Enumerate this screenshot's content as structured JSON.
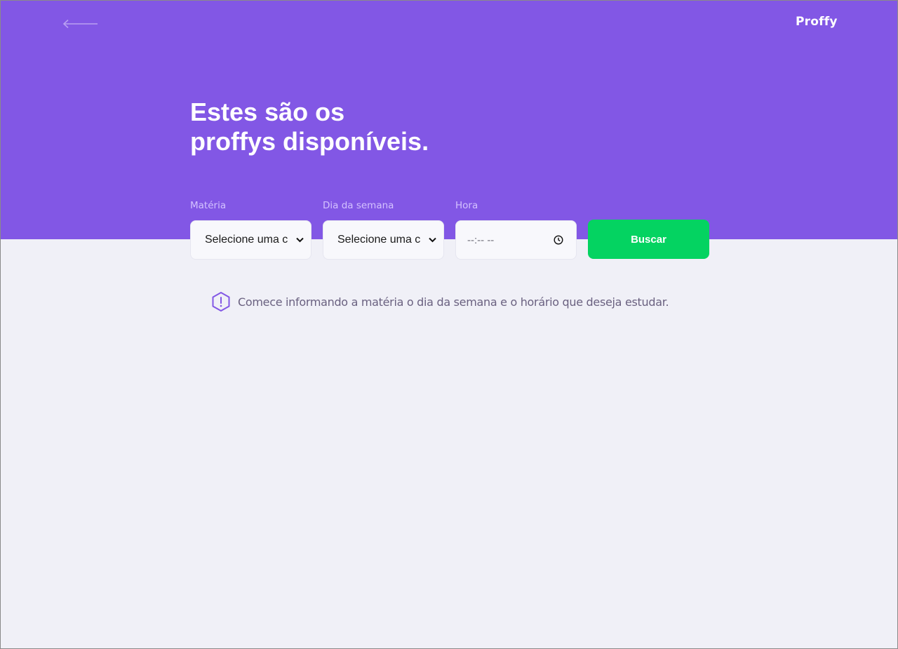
{
  "header": {
    "logo": "Proffy",
    "title_line1": "Estes são os",
    "title_line2": "proffys disponíveis."
  },
  "filters": {
    "subject": {
      "label": "Matéria",
      "value": "Selecione uma c"
    },
    "weekday": {
      "label": "Dia da semana",
      "value": "Selecione uma c"
    },
    "time": {
      "label": "Hora",
      "value": "--:-- --"
    },
    "submit_label": "Buscar"
  },
  "hint": {
    "text": "Comece informando a matéria o dia da semana e o horário que deseja estudar."
  },
  "colors": {
    "primary": "#8257E5",
    "background": "#F0F0F7",
    "button": "#04D361",
    "label": "#D4C2FF",
    "hint_text": "#6A6180"
  },
  "icons": {
    "back": "arrow-left-icon",
    "select": "chevron-down-icon",
    "time": "clock-icon",
    "hint": "warning-hexagon-icon"
  }
}
